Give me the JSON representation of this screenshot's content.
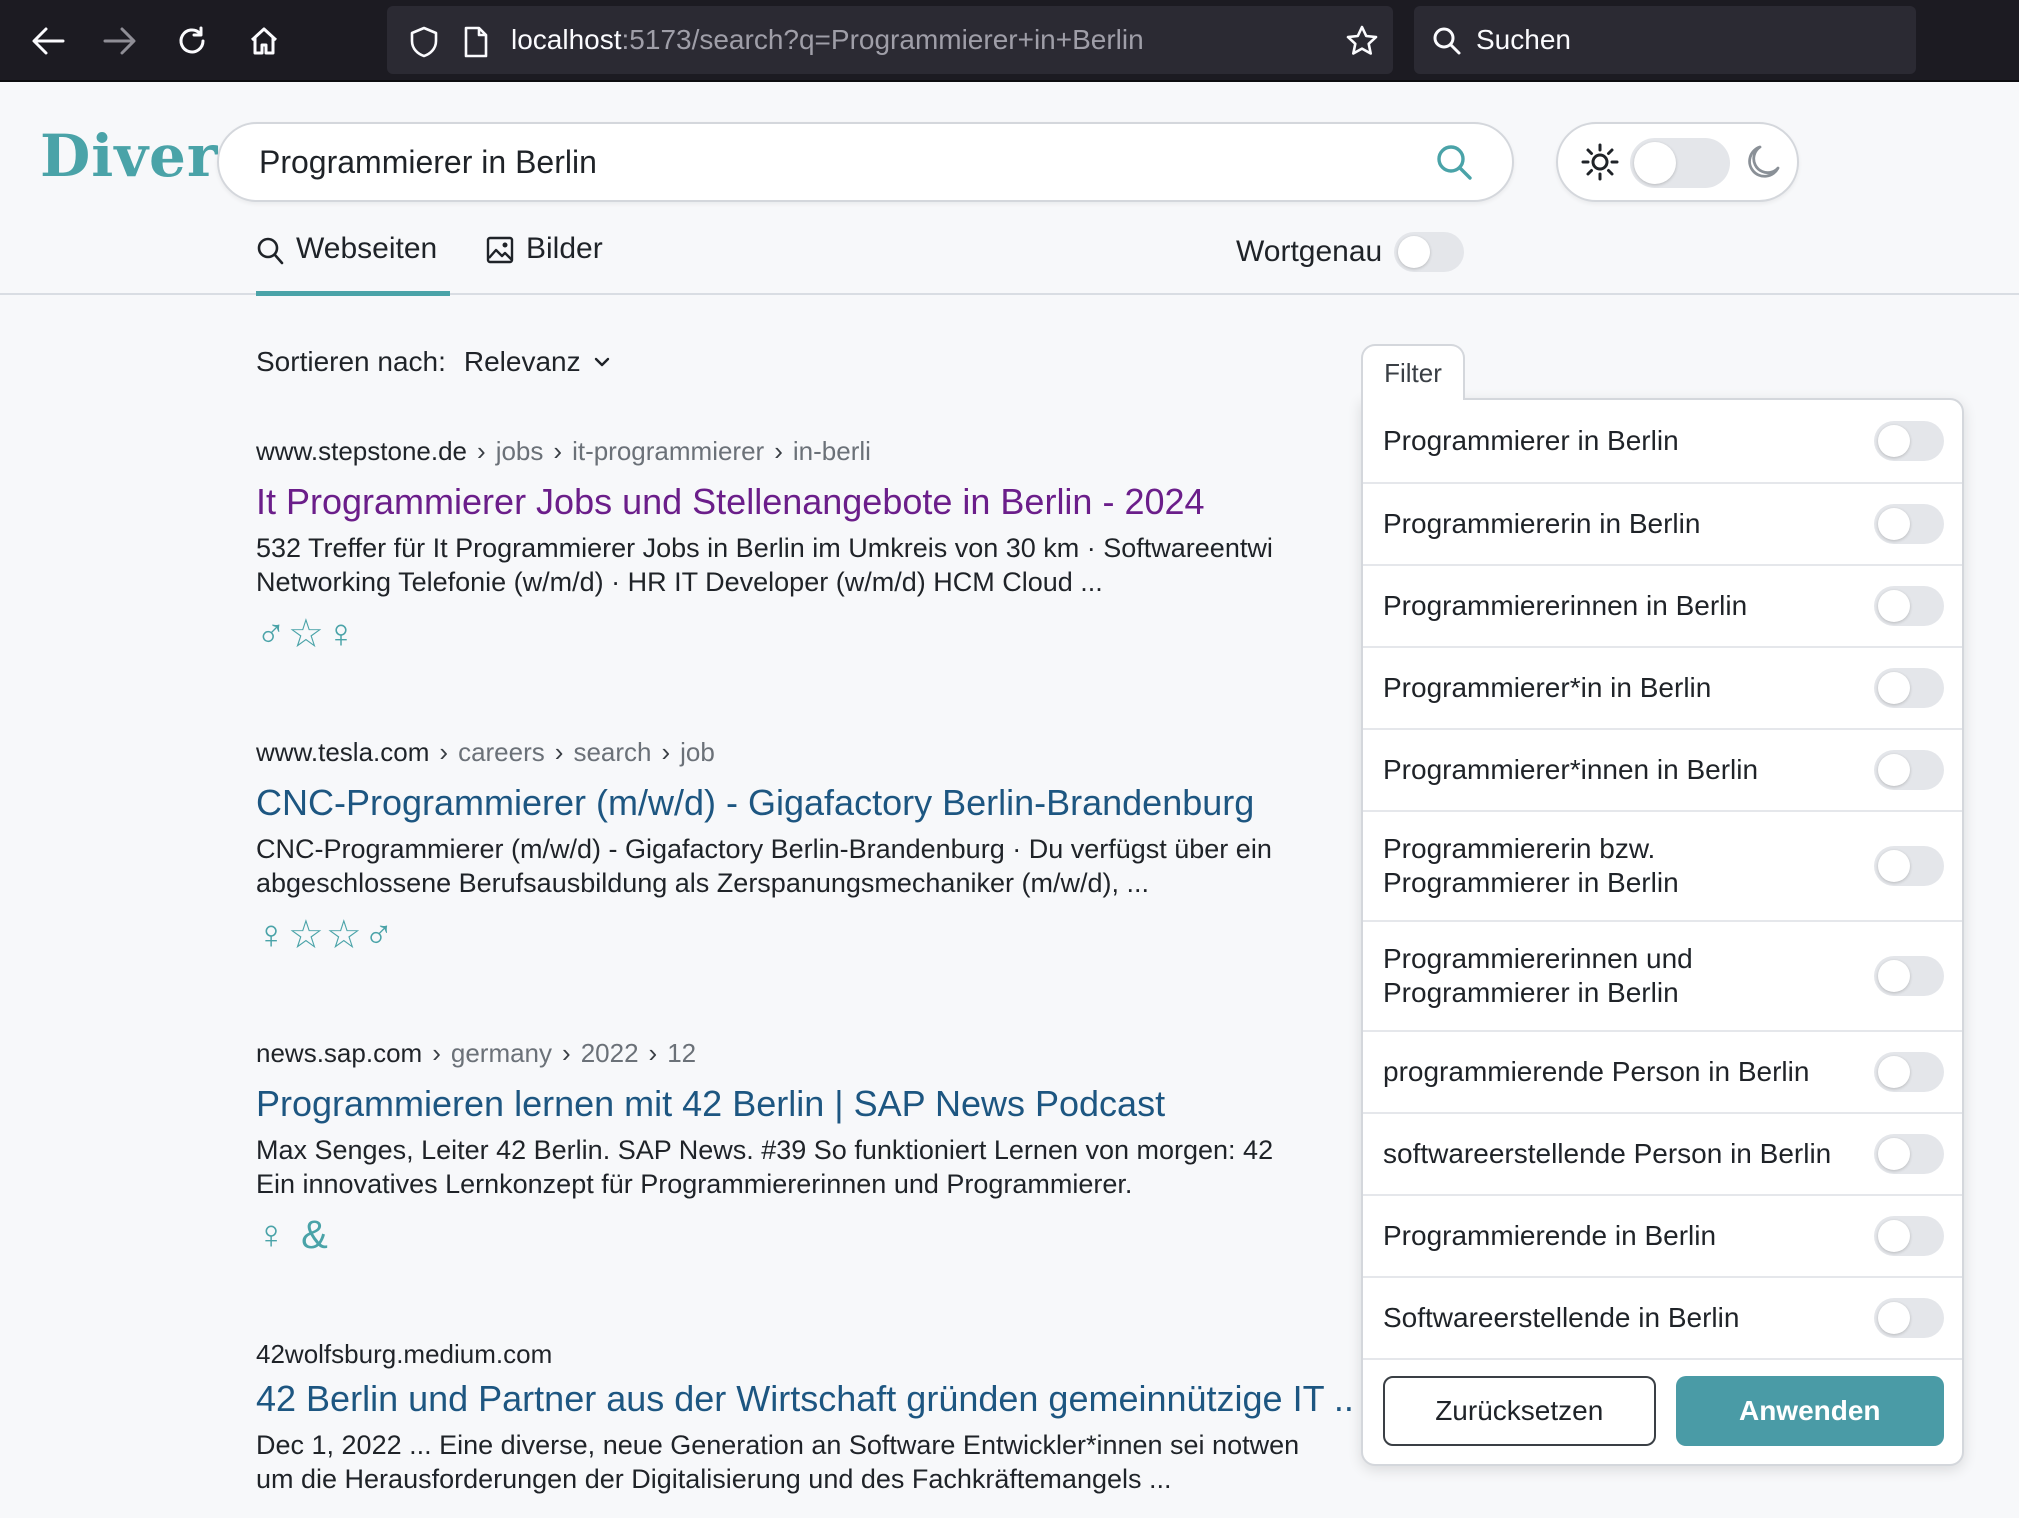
{
  "browser": {
    "url_host": "localhost",
    "url_rest": ":5173/search?q=Programmierer+in+Berlin",
    "search_placeholder": "Suchen"
  },
  "app": {
    "logo": "Diver",
    "query": "Programmierer in Berlin",
    "tabs": [
      {
        "label": "Webseiten",
        "active": true
      },
      {
        "label": "Bilder",
        "active": false
      }
    ],
    "exact_label": "Wortgenau",
    "accent_color": "#4aa3a8"
  },
  "sort": {
    "label": "Sortieren nach:",
    "value": "Relevanz"
  },
  "results": [
    {
      "domain": "www.stepstone.de",
      "path": [
        "jobs",
        "it-programmierer",
        "in-berli"
      ],
      "title": "It Programmierer Jobs und Stellenangebote in Berlin - 2024",
      "snippet1": "532 Treffer für It Programmierer Jobs in Berlin im Umkreis von 30 km · Softwareentwi",
      "snippet2": "Networking Telefonie (w/m/d) · HR IT Developer (w/m/d) HCM Cloud ...",
      "badges": "♂☆♀"
    },
    {
      "domain": "www.tesla.com",
      "path": [
        "careers",
        "search",
        "job"
      ],
      "title": "CNC-Programmierer (m/w/d) - Gigafactory Berlin-Brandenburg",
      "snippet1": "CNC-Programmierer (m/w/d) - Gigafactory Berlin-Brandenburg · Du verfügst über ein",
      "snippet2": "abgeschlossene Berufsausbildung als Zerspanungsmechaniker (m/w/d), ...",
      "badges": "♀☆☆♂"
    },
    {
      "domain": "news.sap.com",
      "path": [
        "germany",
        "2022",
        "12"
      ],
      "title": "Programmieren lernen mit 42 Berlin | SAP News Podcast",
      "snippet1": "Max Senges, Leiter 42 Berlin. SAP News. #39 So funktioniert Lernen von morgen: 42",
      "snippet2": "Ein innovatives Lernkonzept für Programmiererinnen und Programmierer.",
      "badges": "♀ &"
    },
    {
      "domain": "42wolfsburg.medium.com",
      "title": "42 Berlin und Partner aus der Wirtschaft gründen gemeinnützige IT ...",
      "snippet1": "Dec 1, 2022 ... Eine diverse, neue Generation an Software Entwickler*innen sei notwen",
      "snippet2": "um die Herausforderungen der Digitalisierung und des Fachkräftemangels ..."
    }
  ],
  "filter": {
    "tab_label": "Filter",
    "options": [
      "Programmierer in Berlin",
      "Programmiererin in Berlin",
      "Programmiererinnen in Berlin",
      "Programmierer*in in Berlin",
      "Programmierer*innen in Berlin",
      "Programmiererin bzw. Programmierer in Berlin",
      "Programmiererinnen und Programmierer in Berlin",
      "programmierende Person in Berlin",
      "softwareerstellende Person in Berlin",
      "Programmierende in Berlin",
      "Softwareerstellende in Berlin"
    ],
    "reset_label": "Zurücksetzen",
    "apply_label": "Anwenden"
  }
}
